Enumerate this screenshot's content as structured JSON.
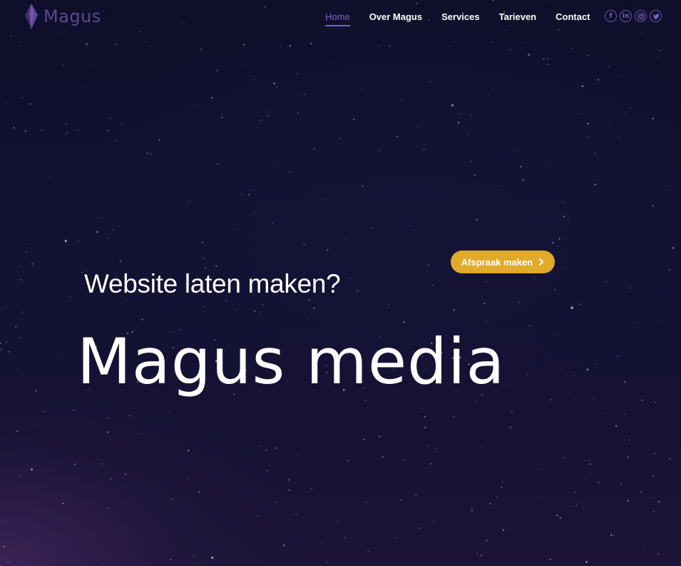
{
  "brand": {
    "name": "Magus",
    "logo_icon": "crystal-gem-icon",
    "logo_color": "#5a4a8c"
  },
  "nav": {
    "items": [
      {
        "label": "Home",
        "active": true
      },
      {
        "label": "Over Magus",
        "active": false
      },
      {
        "label": "Services",
        "active": false
      },
      {
        "label": "Tarieven",
        "active": false
      },
      {
        "label": "Contact",
        "active": false
      }
    ],
    "active_color": "#7a63c0"
  },
  "socials": [
    {
      "name": "facebook",
      "icon": "facebook-icon",
      "glyph": "f"
    },
    {
      "name": "linkedin",
      "icon": "linkedin-icon",
      "glyph": "in"
    },
    {
      "name": "instagram",
      "icon": "instagram-icon",
      "glyph": ""
    },
    {
      "name": "twitter",
      "icon": "twitter-icon",
      "glyph": ""
    }
  ],
  "hero": {
    "subtitle": "Website laten maken?",
    "title": "Magus media",
    "cta_label": "Afspraak maken",
    "cta_icon": "chevron-right-icon",
    "cta_color": "#e2aa2b"
  }
}
